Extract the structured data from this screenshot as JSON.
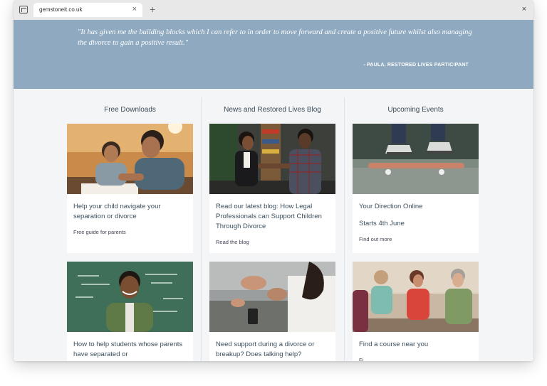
{
  "browser": {
    "tab_title": "gemstoneit.co.uk",
    "tab_close": "×",
    "new_tab": "+",
    "window_close": "×"
  },
  "hero": {
    "quote": "\"It has given me the building blocks which I can refer to in order to move forward and create a positive future whilst also managing the divorce to gain a positive result.\"",
    "attribution": "- PAULA, RESTORED LIVES PARTICIPANT"
  },
  "columns": [
    {
      "title": "Free Downloads",
      "cards": [
        {
          "title": "Help your child navigate your separation or divorce",
          "subtitle": "Free guide for parents",
          "image": "parent-child-homework-photo"
        },
        {
          "title": "How to help students whose parents have separated or",
          "subtitle": "",
          "image": "teacher-chalkboard-photo"
        }
      ]
    },
    {
      "title": "News and Restored Lives Blog",
      "cards": [
        {
          "title": "Read our latest blog: How Legal Professionals can Support Children Through Divorce",
          "subtitle": "Read the blog",
          "image": "handshake-office-photo"
        },
        {
          "title": "Need support during a divorce or breakup? Does talking help?",
          "subtitle": "",
          "image": "conversation-hands-photo"
        }
      ]
    },
    {
      "title": "Upcoming Events",
      "cards": [
        {
          "title": "Your Direction Online",
          "date": "Starts 4th June",
          "subtitle": "Find out more",
          "image": "skateboard-photo"
        },
        {
          "title": "Find a course near you",
          "subtitle": "Fi",
          "image": "group-discussion-photo"
        }
      ]
    }
  ],
  "colors": {
    "hero_background": "#8ea9c0",
    "page_background": "#f3f5f7",
    "card_background": "#ffffff",
    "heading_text": "#3e4c57"
  }
}
